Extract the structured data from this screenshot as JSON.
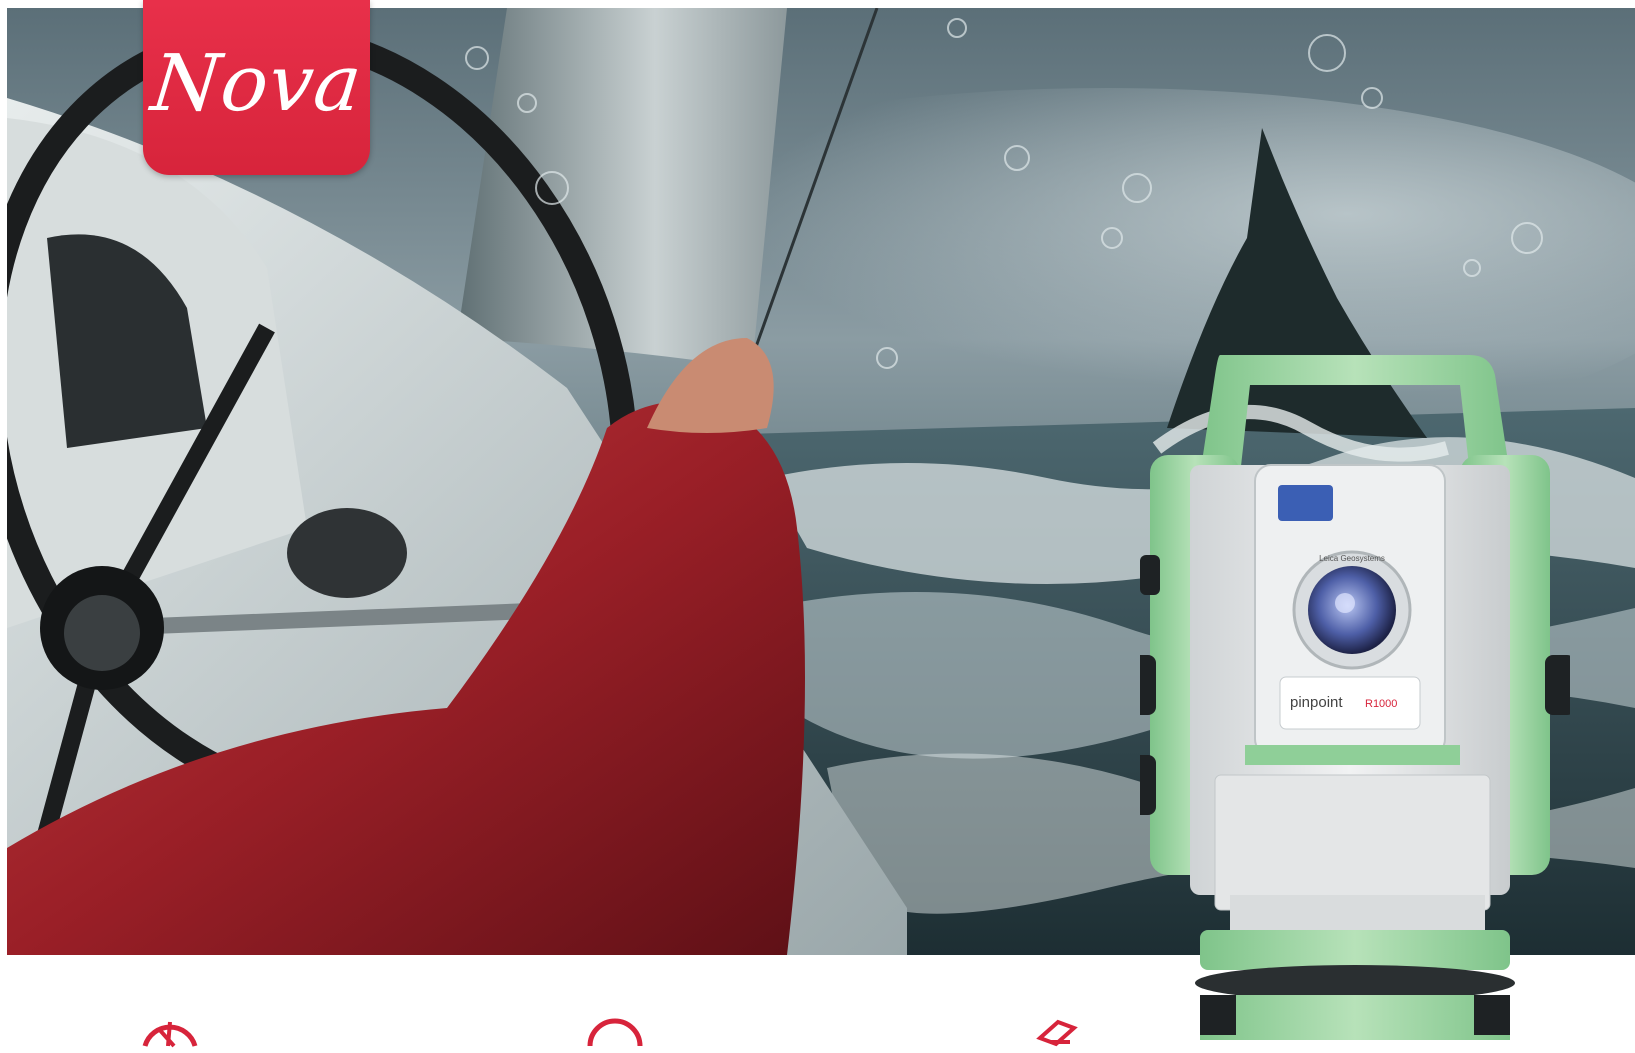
{
  "badge": {
    "label": "Nova"
  },
  "device": {
    "model_prefix": "pinpoint",
    "model_suffix": "R1000",
    "lens_ring_text": "Leica Geosystems"
  },
  "colors": {
    "badge_red": "#d7243b",
    "device_green": "#9fd6a3",
    "device_body": "#e9ebec",
    "jacket_red": "#a7242c",
    "sea": "#30484f"
  },
  "bottom_icons": [
    {
      "icon": "aperture-icon"
    },
    {
      "icon": "lens-icon"
    },
    {
      "icon": "box-icon"
    }
  ]
}
